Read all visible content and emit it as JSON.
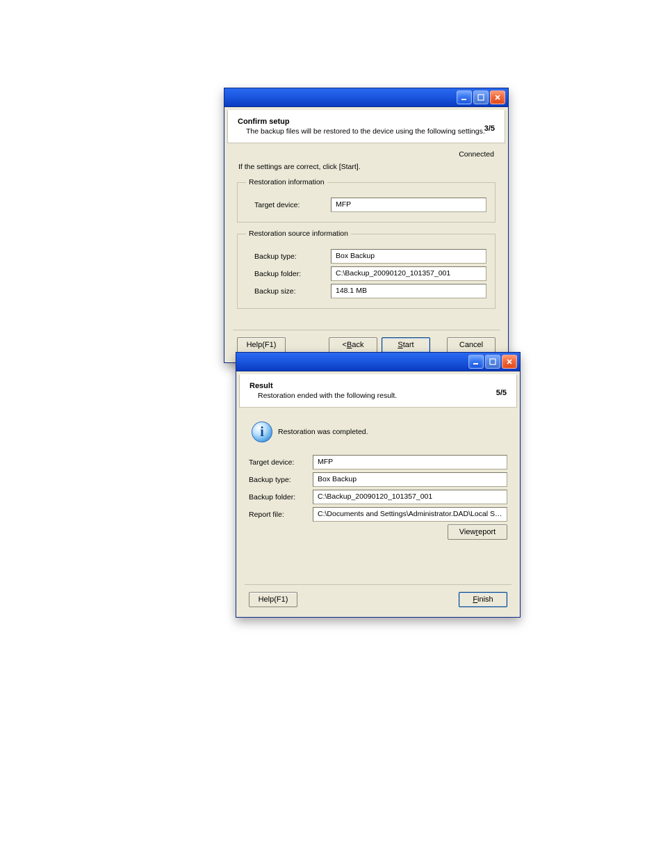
{
  "window1": {
    "header": {
      "title": "Confirm setup",
      "subtitle": "The backup files will be restored to the device using the following settings.",
      "step": "3/5"
    },
    "status": "Connected",
    "instruction": "If the settings are correct, click [Start].",
    "groups": {
      "restoration_info": {
        "legend": "Restoration information",
        "target_device_label": "Target device:",
        "target_device_value": "MFP"
      },
      "source_info": {
        "legend": "Restoration source information",
        "backup_type_label": "Backup type:",
        "backup_type_value": "Box Backup",
        "backup_folder_label": "Backup folder:",
        "backup_folder_value": "C:\\Backup_20090120_101357_001",
        "backup_size_label": "Backup size:",
        "backup_size_value": "148.1 MB"
      }
    },
    "buttons": {
      "help": "Help(F1)",
      "back_prefix": "< ",
      "back_u": "B",
      "back_rest": "ack",
      "start_u": "S",
      "start_rest": "tart",
      "cancel": "Cancel"
    }
  },
  "window2": {
    "header": {
      "title": "Result",
      "subtitle": "Restoration ended with the following result.",
      "step": "5/5"
    },
    "message": "Restoration was completed.",
    "fields": {
      "target_device_label": "Target device:",
      "target_device_value": "MFP",
      "backup_type_label": "Backup type:",
      "backup_type_value": "Box Backup",
      "backup_folder_label": "Backup folder:",
      "backup_folder_value": "C:\\Backup_20090120_101357_001",
      "report_file_label": "Report file:",
      "report_file_value": "C:\\Documents and Settings\\Administrator.DAD\\Local Settings\\Application Data\\KON"
    },
    "buttons": {
      "view_report_pre": "View ",
      "view_report_u": "r",
      "view_report_post": "eport",
      "help": "Help(F1)",
      "finish_u": "F",
      "finish_rest": "inish"
    }
  }
}
